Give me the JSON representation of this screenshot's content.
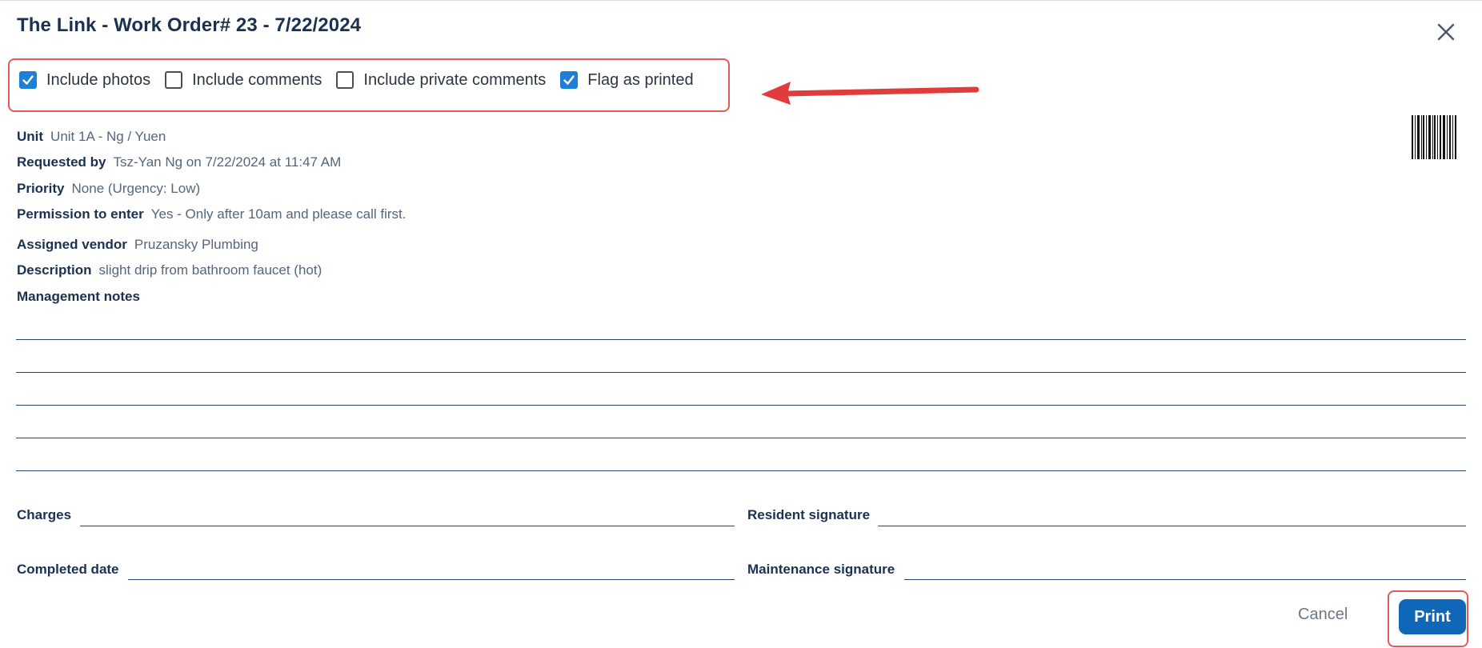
{
  "dialog": {
    "title": "The Link - Work Order# 23 - 7/22/2024",
    "close_icon": "close-icon"
  },
  "options": [
    {
      "label": "Include photos",
      "checked": true
    },
    {
      "label": "Include comments",
      "checked": false
    },
    {
      "label": "Include private comments",
      "checked": false
    },
    {
      "label": "Flag as printed",
      "checked": true
    }
  ],
  "details": {
    "unit": {
      "label": "Unit",
      "value": "Unit 1A - Ng / Yuen"
    },
    "requested_by": {
      "label": "Requested by",
      "value": "Tsz-Yan Ng on 7/22/2024 at 11:47 AM"
    },
    "priority": {
      "label": "Priority",
      "value": "None (Urgency: Low)"
    },
    "permission": {
      "label": "Permission to enter",
      "value": "Yes - Only after 10am and please call first."
    },
    "vendor": {
      "label": "Assigned vendor",
      "value": "Pruzansky Plumbing"
    },
    "description": {
      "label": "Description",
      "value": "slight drip from bathroom faucet (hot)"
    },
    "management_notes": {
      "label": "Management notes"
    }
  },
  "signatures": {
    "charges": "Charges",
    "resident_signature": "Resident signature",
    "completed_date": "Completed date",
    "maintenance_signature": "Maintenance signature"
  },
  "footer": {
    "cancel_label": "Cancel",
    "print_label": "Print"
  },
  "colors": {
    "accent": "#1e7fd6",
    "primary_button": "#1067b8",
    "annotation": "#e35a5a",
    "heading": "#1b3150"
  }
}
